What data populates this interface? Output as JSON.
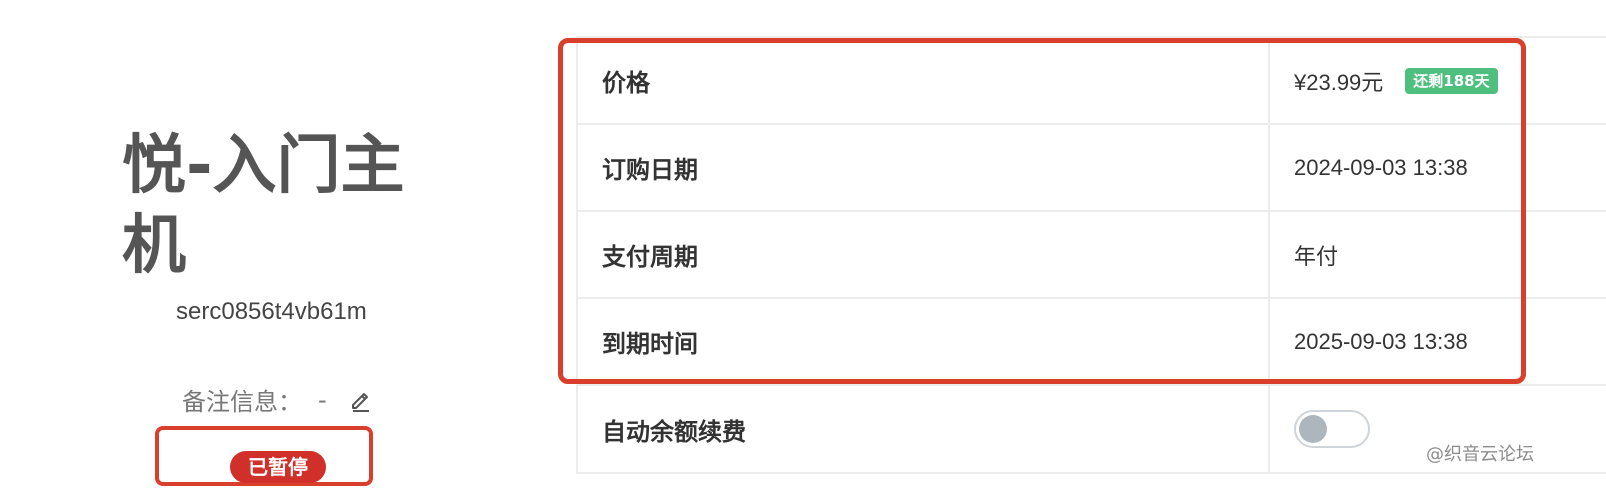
{
  "product": {
    "name": "悦-入门主机",
    "instance_id": "serc0856t4vb61m",
    "remark_label": "备注信息：",
    "remark_value": "-",
    "status": "已暂停"
  },
  "details": {
    "price_label": "价格",
    "price_value": "¥23.99元",
    "remaining_badge": "还剩188天",
    "order_date_label": "订购日期",
    "order_date_value": "2024-09-03 13:38",
    "billing_cycle_label": "支付周期",
    "billing_cycle_value": "年付",
    "expiry_label": "到期时间",
    "expiry_value": "2025-09-03 13:38",
    "auto_renew_label": "自动余额续费",
    "auto_renew_enabled": false
  },
  "watermark": "@织音云论坛",
  "colors": {
    "highlight": "#d93f2a",
    "status_badge": "#d12f2a",
    "remaining_badge": "#4fbf7f",
    "toggle_knob": "#adb5bd"
  },
  "icons": {
    "edit": "pencil-icon"
  }
}
